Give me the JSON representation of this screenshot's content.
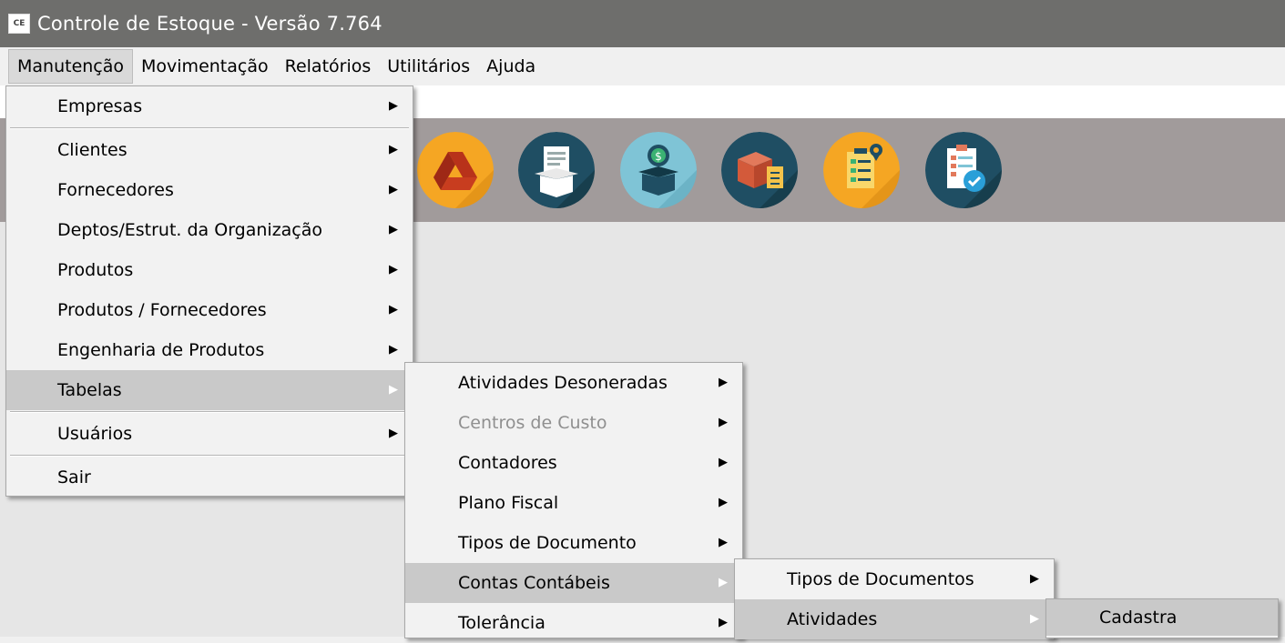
{
  "window": {
    "icon_text": "CE",
    "title": "Controle de Estoque - Versão 7.764"
  },
  "menubar": {
    "items": [
      {
        "label": "Manutenção"
      },
      {
        "label": "Movimentação"
      },
      {
        "label": "Relatórios"
      },
      {
        "label": "Utilitários"
      },
      {
        "label": "Ajuda"
      }
    ]
  },
  "toolbar": {
    "icons": [
      {
        "name": "drive-icon",
        "color": "#f5a623"
      },
      {
        "name": "document-box-icon",
        "color": "#1f4e63"
      },
      {
        "name": "money-box-icon",
        "color": "#7fc4d6"
      },
      {
        "name": "package-checklist-icon",
        "color": "#1f4e63"
      },
      {
        "name": "location-checklist-icon",
        "color": "#f5a623"
      },
      {
        "name": "report-check-icon",
        "color": "#1f4e63"
      }
    ]
  },
  "menu_manutencao": {
    "items": [
      {
        "label": "Empresas",
        "arrow": "▶"
      },
      {
        "label": "Clientes",
        "arrow": "▶"
      },
      {
        "label": "Fornecedores",
        "arrow": "▶"
      },
      {
        "label": "Deptos/Estrut. da Organização",
        "arrow": "▶"
      },
      {
        "label": "Produtos",
        "arrow": "▶"
      },
      {
        "label": "Produtos / Fornecedores",
        "arrow": "▶"
      },
      {
        "label": "Engenharia de Produtos",
        "arrow": "▶"
      },
      {
        "label": "Tabelas",
        "arrow": "▶"
      },
      {
        "label": "Usuários",
        "arrow": "▶"
      },
      {
        "label": "Sair"
      }
    ]
  },
  "menu_tabelas": {
    "items": [
      {
        "label": "Atividades Desoneradas",
        "arrow": "▶"
      },
      {
        "label": "Centros de Custo",
        "arrow": "▶"
      },
      {
        "label": "Contadores",
        "arrow": "▶"
      },
      {
        "label": "Plano Fiscal",
        "arrow": "▶"
      },
      {
        "label": "Tipos de Documento",
        "arrow": "▶"
      },
      {
        "label": "Contas Contábeis",
        "arrow": "▶"
      },
      {
        "label": "Tolerância",
        "arrow": "▶"
      }
    ]
  },
  "menu_contas": {
    "items": [
      {
        "label": "Tipos de Documentos",
        "arrow": "▶"
      },
      {
        "label": "Atividades",
        "arrow": "▶"
      }
    ]
  },
  "menu_atividades": {
    "items": [
      {
        "label": "Cadastra"
      }
    ]
  }
}
